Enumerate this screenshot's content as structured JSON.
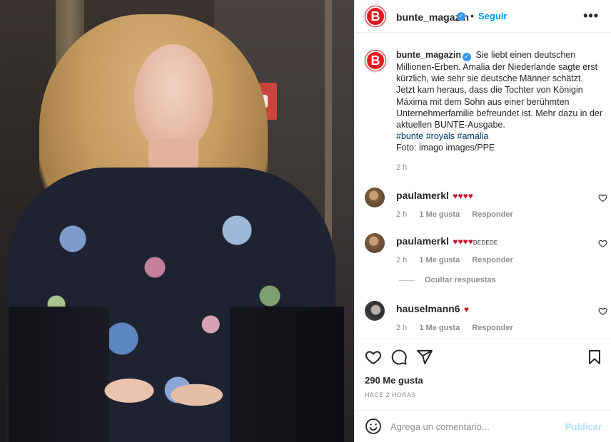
{
  "post": {
    "username": "bunte_magazin",
    "logo_letter": "B",
    "follow_label": "Seguir",
    "more_label": "•••",
    "dot": "•"
  },
  "caption": {
    "username": "bunte_magazin",
    "text": "Sie liebt einen deutschen Millionen-Erben. Amalia der Niederlande sagte erst kürzlich, wie sehr sie deutsche Männer schätzt. Jetzt kam heraus, dass die Tochter von Königin Máxima mit dem Sohn aus einer berühmten Unternehmerfamilie befreundet ist. Mehr dazu in der aktuellen BUNTE-Ausgabe.",
    "hashtags": [
      "#bunte",
      "#royals",
      "#amalia"
    ],
    "credit": "Foto: imago images/PPE",
    "time": "2 h"
  },
  "comments": [
    {
      "username": "paulamerkl",
      "hearts": "♥♥♥♥",
      "extra": "",
      "time": "2 h",
      "likes": "1 Me gusta",
      "reply": "Responder"
    },
    {
      "username": "paulamerkl",
      "hearts": "♥♥♥♥",
      "extra": "DEDEDE",
      "time": "2 h",
      "likes": "1 Me gusta",
      "reply": "Responder"
    },
    {
      "username": "hauselmann6",
      "hearts": "♥",
      "extra": "",
      "time": "2 h",
      "likes": "1 Me gusta",
      "reply": "Responder"
    }
  ],
  "hide_replies_label": "Ocultar respuestas",
  "stats": {
    "likes": "290 Me gusta",
    "posted_ago": "HACE 2 HORAS"
  },
  "add_comment": {
    "placeholder": "Agrega un comentario...",
    "publish_label": "Publicar"
  },
  "colors": {
    "accent_blue": "#0095f6",
    "brand_red": "#e11a22",
    "heart_red": "#c6162c",
    "muted": "#8e8e8e"
  },
  "icons": [
    "verified-badge-icon",
    "more-options-icon",
    "heart-icon",
    "comment-icon",
    "share-icon",
    "bookmark-icon",
    "emoji-icon"
  ]
}
